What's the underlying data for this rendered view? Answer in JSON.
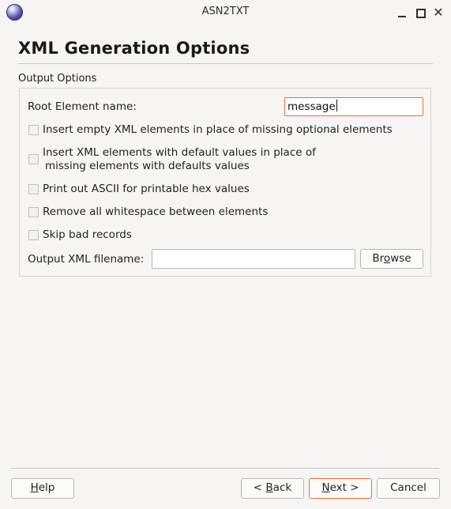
{
  "window": {
    "title": "ASN2TXT",
    "icon": "app-globe-icon",
    "controls": [
      "minimize-icon",
      "maximize-icon",
      "close-icon"
    ]
  },
  "page": {
    "title": "XML Generation Options"
  },
  "group": {
    "label": "Output Options"
  },
  "root_element": {
    "label": "Root Element name:",
    "value": "message"
  },
  "options": [
    {
      "line1": "Insert empty XML elements in place of missing optional elements",
      "line2": "",
      "checked": false
    },
    {
      "line1": "Insert XML elements with default values in place of",
      "line2": "missing elements with defaults values",
      "checked": false
    },
    {
      "line1": "Print out ASCII for printable hex values",
      "line2": "",
      "checked": false
    },
    {
      "line1": "Remove all whitespace between elements",
      "line2": "",
      "checked": false
    },
    {
      "line1": "Skip bad records",
      "line2": "",
      "checked": false
    }
  ],
  "output_file": {
    "label": "Output XML filename:",
    "value": ""
  },
  "buttons": {
    "browse": {
      "pre": "Br",
      "mn": "o",
      "post": "wse"
    },
    "help": {
      "pre": "",
      "mn": "H",
      "post": "elp"
    },
    "back": {
      "pre": "< ",
      "mn": "B",
      "post": "ack"
    },
    "next": {
      "pre": "",
      "mn": "N",
      "post": "ext >"
    },
    "cancel": {
      "pre": "Cancel",
      "mn": "",
      "post": ""
    }
  },
  "colors": {
    "focus_accent": "#e8703a",
    "background": "#f6f5f4"
  }
}
